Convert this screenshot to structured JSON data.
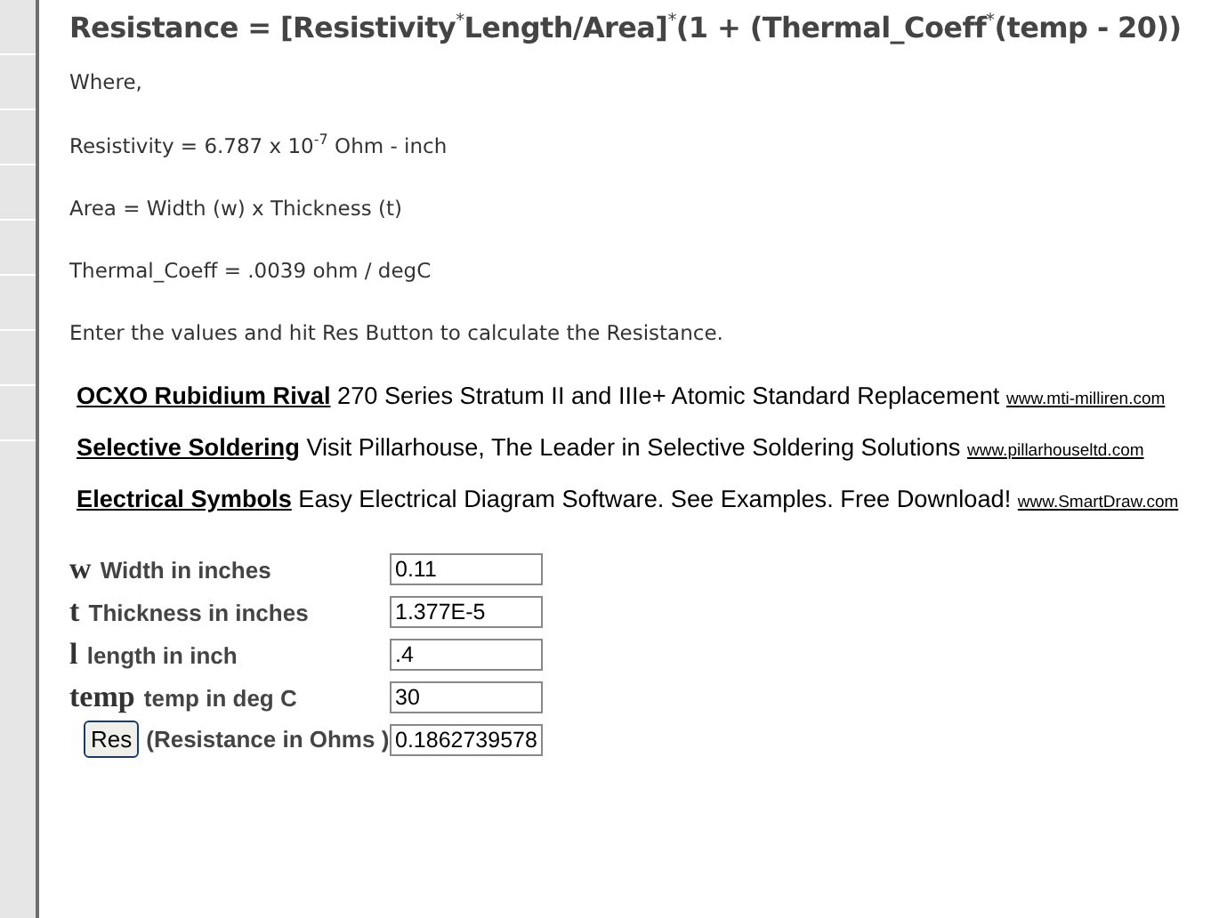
{
  "formula": "Resistance = [Resistivity$^{*}$Length/Area]$^{*}$(1 + (Thermal_Coeff$^{*}$(temp - 20))",
  "notes": [
    "Where,",
    "Resistivity = 6.787 x 10$^{-7}$ Ohm - inch",
    "Area = Width (w) x Thickness (t)",
    "Thermal_Coeff = .0039 ohm / degC",
    "Enter the values and hit Res Button to calculate the Resistance."
  ],
  "ads": [
    {
      "title": "OCXO Rubidium Rival",
      "text": "270 Series Stratum II and IIIe+ Atomic Standard Replacement",
      "url": "www.mti-milliren.com"
    },
    {
      "title": "Selective Soldering",
      "text": "Visit Pillarhouse, The Leader in Selective Soldering Solutions",
      "url": "www.pillarhouseltd.com"
    },
    {
      "title": "Electrical Symbols",
      "text": "Easy Electrical Diagram Software. See Examples. Free Download!",
      "url": "www.SmartDraw.com"
    }
  ],
  "inputs": [
    {
      "symbol": "w",
      "label": "Width in inches",
      "value": "0.11"
    },
    {
      "symbol": "t",
      "label": "Thickness in inches",
      "value": "1.377E-5"
    },
    {
      "symbol": "l",
      "label": "length in inch",
      "value": ".4"
    },
    {
      "symbol": "temp",
      "label": "temp in deg C",
      "value": "30"
    }
  ],
  "result": {
    "button": "Res",
    "label": "(Resistance in Ohms )",
    "value": "0.1862739578"
  }
}
